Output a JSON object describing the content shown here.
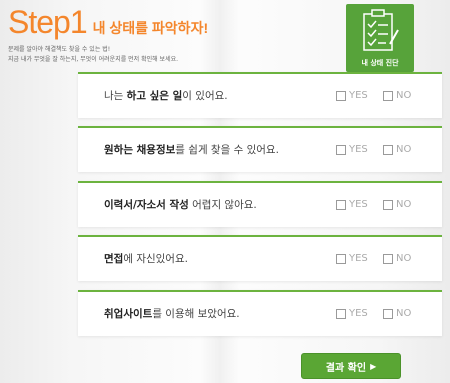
{
  "header": {
    "step": "Step1",
    "subtitle": "내 상태를 파악하자!",
    "desc_line1": "문제를 알아야 해결책도 찾을 수 있는 법!",
    "desc_line2": "지금 내가 무엇을 잘 하는지, 무엇이 어려운지를 먼저 확인해 보세요."
  },
  "badge": {
    "label": "내 상태 진단",
    "icon": "checklist-icon"
  },
  "options": {
    "yes": "YES",
    "no": "NO"
  },
  "questions": [
    {
      "pre": "나는 ",
      "highlight": "하고 싶은 일",
      "post": "이 있어요."
    },
    {
      "pre": "",
      "highlight": "원하는 채용정보",
      "post": "를 쉽게 찾을 수 있어요."
    },
    {
      "pre": "",
      "highlight": "이력서/자소서 작성",
      "post": " 어렵지 않아요."
    },
    {
      "pre": "",
      "highlight": "면접",
      "post": "에 자신있어요."
    },
    {
      "pre": "",
      "highlight": "취업사이트",
      "post": "를 이용해 보았어요."
    }
  ],
  "button": {
    "label": "결과 확인",
    "arrow": "▶"
  },
  "colors": {
    "accent_orange": "#f4862c",
    "accent_green": "#5aa634"
  }
}
